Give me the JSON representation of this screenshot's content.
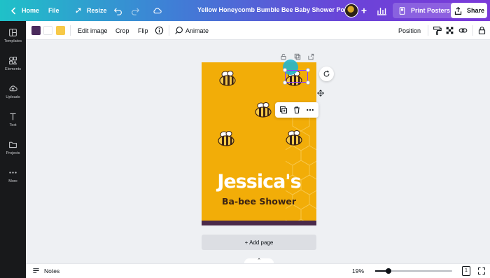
{
  "header": {
    "home_label": "Home",
    "file_label": "File",
    "resize_label": "Resize",
    "doc_title": "Yellow Honeycomb Bumble Bee Baby Shower Poster",
    "print_label": "Print Posters",
    "share_label": "Share"
  },
  "sidebar": {
    "items": [
      {
        "label": "Templates",
        "icon": "templates-icon"
      },
      {
        "label": "Elements",
        "icon": "elements-icon"
      },
      {
        "label": "Uploads",
        "icon": "upload-icon"
      },
      {
        "label": "Text",
        "icon": "text-icon"
      },
      {
        "label": "Projects",
        "icon": "folder-icon"
      },
      {
        "label": "More",
        "icon": "more-icon"
      }
    ]
  },
  "toolbar": {
    "color_1": "#4a2a5c",
    "color_2": "#ffffff",
    "color_3": "#f7c948",
    "edit_image_label": "Edit image",
    "crop_label": "Crop",
    "flip_label": "Flip",
    "animate_label": "Animate",
    "position_label": "Position"
  },
  "poster": {
    "title": "Jessica's",
    "subtitle": "Ba-bee Shower",
    "background_color": "#f2ad08",
    "stripe_color": "#4a2a4a"
  },
  "canvas": {
    "add_page_label": "+ Add page"
  },
  "bottombar": {
    "notes_label": "Notes",
    "zoom_label": "19%",
    "zoom_level_percent": 19,
    "page_count": "1"
  }
}
